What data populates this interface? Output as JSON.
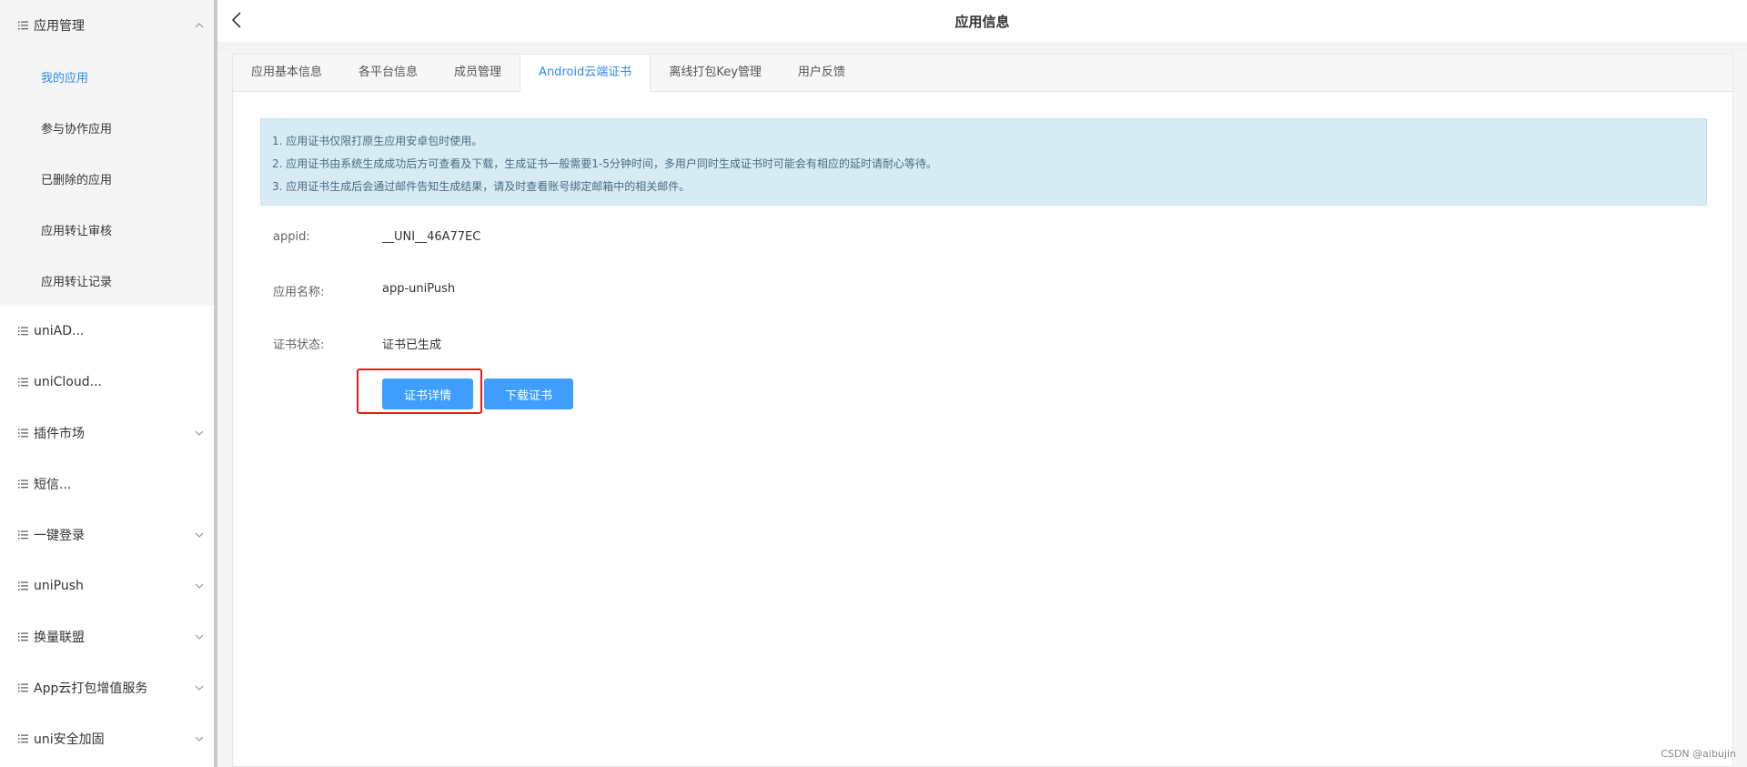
{
  "sidebar": {
    "groups": [
      {
        "label": "应用管理",
        "expanded": true,
        "items": [
          {
            "label": "我的应用",
            "active": true
          },
          {
            "label": "参与协作应用"
          },
          {
            "label": "已删除的应用"
          },
          {
            "label": "应用转让审核"
          },
          {
            "label": "应用转让记录"
          }
        ]
      },
      {
        "label": "uniAD...",
        "chevron": false
      },
      {
        "label": "uniCloud...",
        "chevron": false
      },
      {
        "label": "插件市场",
        "chevron": true
      },
      {
        "label": "短信...",
        "chevron": false
      },
      {
        "label": "一键登录",
        "chevron": true
      },
      {
        "label": "uniPush",
        "chevron": true
      },
      {
        "label": "换量联盟",
        "chevron": true
      },
      {
        "label": "App云打包增值服务",
        "chevron": true
      },
      {
        "label": "uni安全加固",
        "chevron": true
      }
    ]
  },
  "header": {
    "title": "应用信息"
  },
  "tabs": [
    {
      "label": "应用基本信息"
    },
    {
      "label": "各平台信息"
    },
    {
      "label": "成员管理"
    },
    {
      "label": "Android云端证书",
      "active": true
    },
    {
      "label": "离线打包Key管理"
    },
    {
      "label": "用户反馈"
    }
  ],
  "notice": {
    "lines": [
      "1. 应用证书仅限打原生应用安卓包时使用。",
      "2. 应用证书由系统生成成功后方可查看及下载，生成证书一般需要1-5分钟时间，多用户同时生成证书时可能会有相应的延时请耐心等待。",
      "3. 应用证书生成后会通过邮件告知生成结果，请及时查看账号绑定邮箱中的相关邮件。"
    ]
  },
  "fields": {
    "appid": {
      "label": "appid:",
      "value": "__UNI__46A77EC"
    },
    "app_name": {
      "label": "应用名称:",
      "value": "app-uniPush"
    },
    "cert_status": {
      "label": "证书状态:",
      "value": "证书已生成"
    }
  },
  "buttons": {
    "cert_detail": "证书详情",
    "download_cert": "下载证书"
  },
  "watermark": "CSDN @aibujin",
  "colors": {
    "accent": "#2d8cf0",
    "button": "#409eff",
    "highlight": "#e61a1a",
    "notice_bg": "#d7ebf4"
  }
}
